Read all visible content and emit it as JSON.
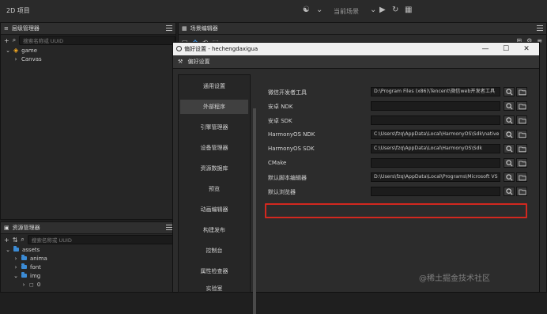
{
  "app": {
    "title": "2D 项目",
    "top_right": "当前场景"
  },
  "hierarchy_panel": {
    "header": "层级管理器",
    "search_placeholder": "搜索名称或 UUID",
    "tree": [
      {
        "label": "game",
        "level": 0,
        "expanded": true
      },
      {
        "label": "Canvas",
        "level": 1,
        "expanded": false
      }
    ]
  },
  "assets_panel": {
    "header": "资源管理器",
    "search_placeholder": "搜索名称或 UUID",
    "tree": [
      {
        "label": "assets",
        "level": 0,
        "expanded": true
      },
      {
        "label": "anima",
        "level": 1,
        "expanded": false
      },
      {
        "label": "font",
        "level": 1,
        "expanded": false
      },
      {
        "label": "img",
        "level": 1,
        "expanded": true
      },
      {
        "label": "0",
        "level": 2,
        "expanded": false
      }
    ]
  },
  "scene_tab": {
    "header": "场景编辑器"
  },
  "dialog": {
    "title": "偏好设置 - hechengdaxigua",
    "subtab": "偏好设置",
    "sidebar": [
      {
        "label": "通用设置",
        "active": false
      },
      {
        "label": "外部程序",
        "active": true
      },
      {
        "label": "引擎管理器",
        "active": false
      },
      {
        "label": "设备管理器",
        "active": false
      },
      {
        "label": "资源数据库",
        "active": false
      },
      {
        "label": "预览",
        "active": false
      },
      {
        "label": "动画编辑器",
        "active": false
      },
      {
        "label": "构建发布",
        "active": false
      },
      {
        "label": "控制台",
        "active": false
      },
      {
        "label": "属性检查器",
        "active": false
      },
      {
        "label": "实验室",
        "active": false
      }
    ],
    "settings": [
      {
        "label": "微信开发者工具",
        "value": "D:\\Program Files (x86)\\Tencent\\微信web开发者工具"
      },
      {
        "label": "安卓 NDK",
        "value": ""
      },
      {
        "label": "安卓 SDK",
        "value": ""
      },
      {
        "label": "HarmonyOS NDK",
        "value": "C:\\Users\\fzq\\AppData\\Local\\HarmonyOS\\Sdk\\native"
      },
      {
        "label": "HarmonyOS SDK",
        "value": "C:\\Users\\fzq\\AppData\\Local\\HarmonyOS\\Sdk"
      },
      {
        "label": "CMake",
        "value": ""
      },
      {
        "label": "默认脚本编辑器",
        "value": "D:\\Users\\fzq\\AppData\\Local\\Programs\\Microsoft VS"
      },
      {
        "label": "默认浏览器",
        "value": ""
      }
    ]
  },
  "watermark": "@稀土掘金技术社区",
  "colors": {
    "highlight": "#d2281f",
    "accent": "#3b8bd5"
  }
}
